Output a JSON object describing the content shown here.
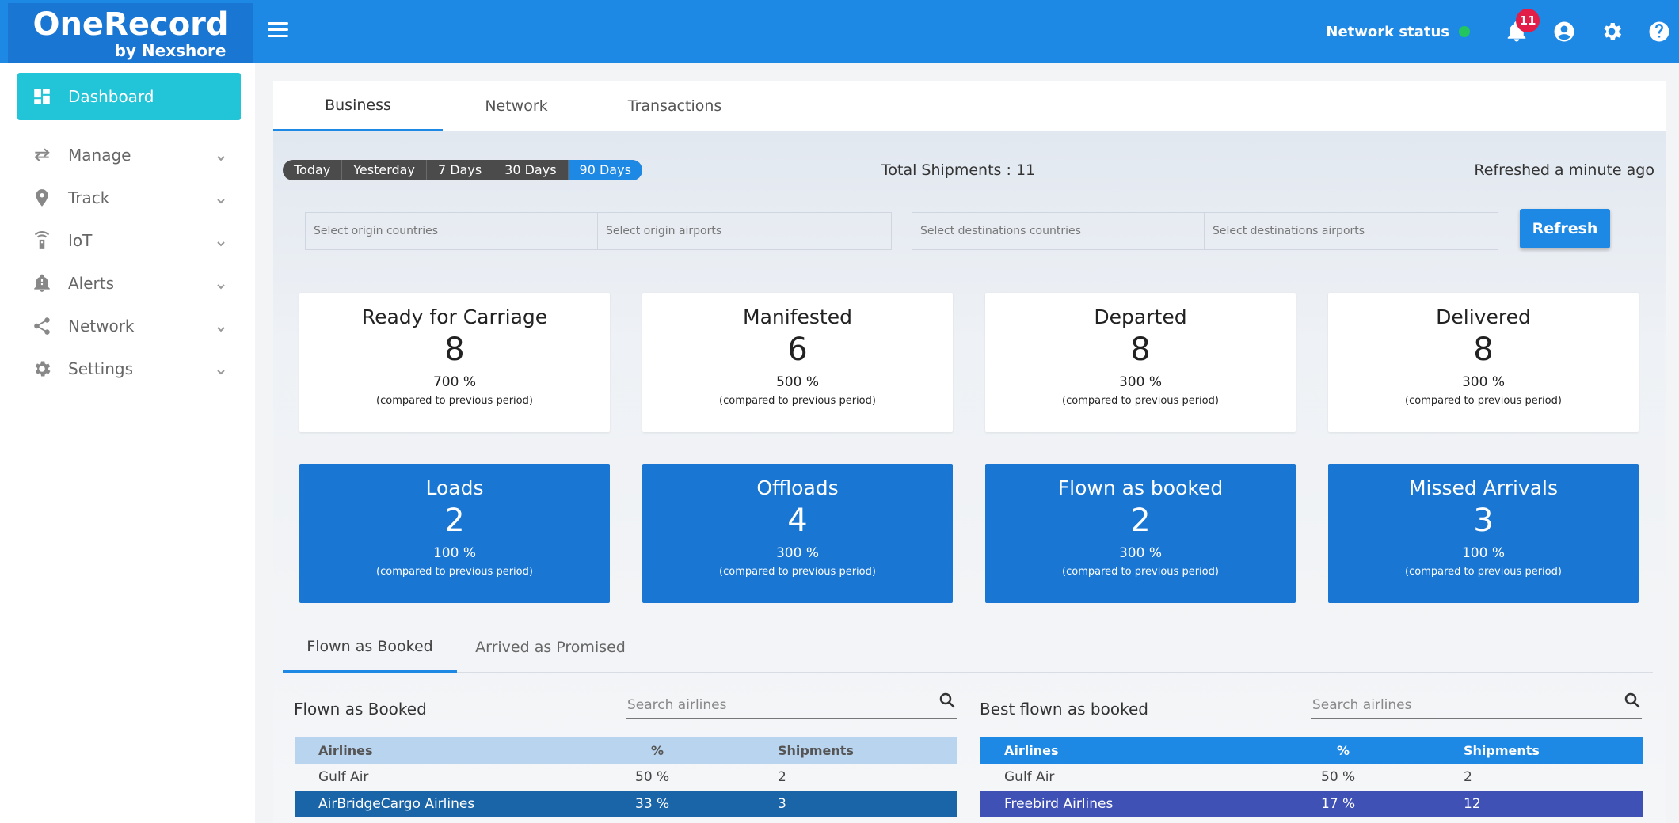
{
  "brand": {
    "name": "OneRecord",
    "sub": "by Nexshore"
  },
  "header": {
    "network_status_label": "Network status",
    "notifications_count": "11"
  },
  "sidebar": {
    "items": [
      {
        "label": "Dashboard",
        "icon": "dashboard-icon"
      },
      {
        "label": "Manage",
        "icon": "swap-arrows-icon"
      },
      {
        "label": "Track",
        "icon": "location-pin-icon"
      },
      {
        "label": "IoT",
        "icon": "iot-sensor-icon"
      },
      {
        "label": "Alerts",
        "icon": "bell-alert-icon"
      },
      {
        "label": "Network",
        "icon": "share-network-icon"
      },
      {
        "label": "Settings",
        "icon": "gear-icon"
      }
    ]
  },
  "main": {
    "tabs": [
      "Business",
      "Network",
      "Transactions"
    ],
    "periods": [
      "Today",
      "Yesterday",
      "7 Days",
      "30 Days",
      "90 Days"
    ],
    "total_shipments_label": "Total Shipments :",
    "total_shipments_value": "11",
    "refreshed": "Refreshed a minute ago",
    "filters": {
      "origin_countries": "Select origin countries",
      "origin_airports": "Select origin airports",
      "dest_countries": "Select destinations countries",
      "dest_airports": "Select destinations airports"
    },
    "refresh_label": "Refresh",
    "compare_note": "(compared to previous period)",
    "status_cards": [
      {
        "title": "Ready for Carriage",
        "value": "8",
        "pct": "700 %"
      },
      {
        "title": "Manifested",
        "value": "6",
        "pct": "500 %"
      },
      {
        "title": "Departed",
        "value": "8",
        "pct": "300 %"
      },
      {
        "title": "Delivered",
        "value": "8",
        "pct": "300 %"
      }
    ],
    "metric_cards": [
      {
        "title": "Loads",
        "value": "2",
        "pct": "100 %"
      },
      {
        "title": "Offloads",
        "value": "4",
        "pct": "300 %"
      },
      {
        "title": "Flown as booked",
        "value": "2",
        "pct": "300 %"
      },
      {
        "title": "Missed Arrivals",
        "value": "3",
        "pct": "100 %"
      }
    ],
    "sub_tabs": [
      "Flown as Booked",
      "Arrived as Promised"
    ],
    "left_panel": {
      "title": "Flown as Booked",
      "search_placeholder": "Search airlines",
      "headers": [
        "Airlines",
        "%",
        "Shipments"
      ],
      "rows": [
        [
          "Gulf Air",
          "50 %",
          "2"
        ],
        [
          "AirBridgeCargo Airlines",
          "33 %",
          "3"
        ]
      ]
    },
    "right_panel": {
      "title": "Best flown as booked",
      "search_placeholder": "Search airlines",
      "headers": [
        "Airlines",
        "%",
        "Shipments"
      ],
      "rows": [
        [
          "Gulf Air",
          "50 %",
          "2"
        ],
        [
          "Freebird Airlines",
          "17 %",
          "12"
        ]
      ]
    }
  }
}
